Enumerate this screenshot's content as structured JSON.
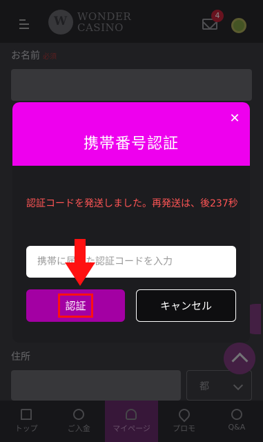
{
  "header": {
    "logo_line1": "WONDER",
    "logo_line2": "CASINO",
    "mail_badge": "4"
  },
  "form": {
    "name_label": "お名前",
    "required_label": "必須",
    "address_label": "住所",
    "prefecture_suffix": "都"
  },
  "modal": {
    "title": "携帯番号認証",
    "close_symbol": "✕",
    "message": "認証コードを発送しました。再発送は、後237秒",
    "code_input_placeholder": "携帯に届いた認証コードを入力",
    "verify_label": "認証",
    "cancel_label": "キャンセル",
    "header_color": "#ee00ee",
    "verify_color": "#a300a3",
    "message_color": "#ff5555",
    "annotation_color": "#ff1111"
  },
  "bottom_nav": {
    "items": [
      {
        "label": "トップ",
        "icon": "home-icon"
      },
      {
        "label": "ご入金",
        "icon": "deposit-icon"
      },
      {
        "label": "マイページ",
        "icon": "user-icon",
        "active": true
      },
      {
        "label": "プロモ",
        "icon": "rocket-icon"
      },
      {
        "label": "Q&A",
        "icon": "help-icon"
      }
    ]
  }
}
